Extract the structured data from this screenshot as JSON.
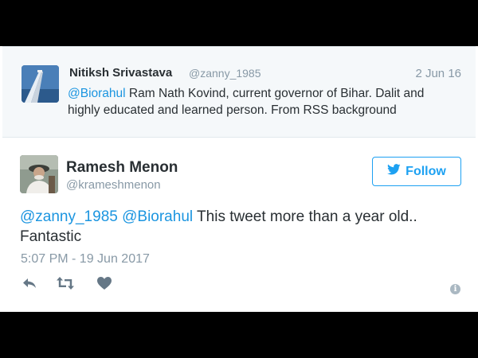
{
  "quoted_tweet": {
    "name": "Nitiksh Srivastava",
    "handle": "@zanny_1985",
    "date": "2 Jun 16",
    "mention": "@Biorahul",
    "text_line1": " Ram Nath Kovind, current governor of Bihar. Dalit and",
    "text_line2": "highly educated and learned person. From RSS background"
  },
  "main_tweet": {
    "name": "Ramesh Menon",
    "handle": "@krameshmenon",
    "follow_label": "Follow",
    "mention1": "@zanny_1985",
    "mention2": "@Biorahul",
    "text_line1": " This tweet more than a year old..",
    "text_line2": "Fantastic",
    "timestamp": "5:07 PM - 19 Jun 2017"
  },
  "actions": [
    "reply-icon",
    "retweet-icon",
    "like-icon",
    "info-icon"
  ],
  "colors": {
    "mention": "#1b95e0",
    "follow": "#1da1f2",
    "muted": "#8899a6",
    "icon": "#657786"
  }
}
